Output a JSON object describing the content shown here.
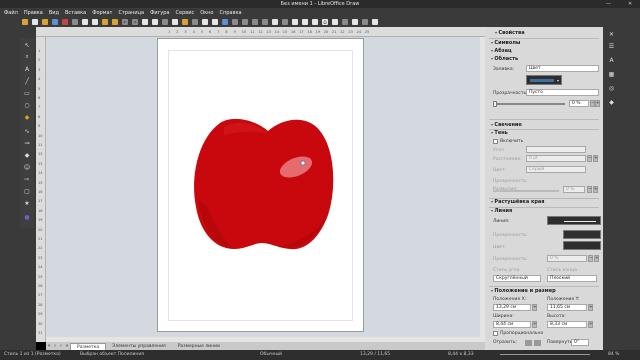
{
  "window": {
    "title": "Без имени 1 - LibreOffice Draw",
    "controls": [
      "—",
      "✕"
    ]
  },
  "menu": [
    "Файл",
    "Правка",
    "Вид",
    "Вставка",
    "Формат",
    "Страница",
    "Фигура",
    "Сервис",
    "Окно",
    "Справка"
  ],
  "ruler": {
    "top": [
      "1",
      "2",
      "3",
      "4",
      "5",
      "6",
      "7",
      "8",
      "9",
      "10",
      "11",
      "12",
      "13",
      "14",
      "15",
      "16",
      "17",
      "18",
      "19",
      "20",
      "21",
      "22",
      "23",
      "24",
      "25"
    ],
    "left": [
      "1",
      "2",
      "3",
      "4",
      "5",
      "6",
      "7",
      "8",
      "9",
      "10",
      "11",
      "12",
      "13",
      "14",
      "15",
      "16",
      "17",
      "18",
      "19",
      "20",
      "21",
      "22",
      "23",
      "24",
      "25",
      "26",
      "27",
      "28",
      "29",
      "30",
      "31"
    ]
  },
  "tabs": {
    "items": [
      "Разметка",
      "Элементы управления",
      "Размерные линии"
    ],
    "active": 0
  },
  "status": {
    "slide": "Стиль 1 из 1 (Разметка)",
    "selection": "Выбран объект Полилиния",
    "layer": "Обычный",
    "position": "13,29 / 11,65",
    "size": "8,44 x 8,33",
    "zoom": "84 %"
  },
  "sidebar": {
    "properties": "Свойства",
    "symbols": "Символы",
    "fill_section": "Абзац",
    "area": "Область",
    "fill_label": "Заливка:",
    "fill_value": "Цвет",
    "transparency_label": "Прозрачность:",
    "transparency_value": "Пусто",
    "transparency_percent": "0 %",
    "glow": "Свечение",
    "shadow": "Тень",
    "shadow_enable": "Включить",
    "shadow_angle_label": "Угол",
    "shadow_distance_label": "Расстояние:",
    "shadow_distance_value": "0 pt",
    "shadow_color_label": "Цвет:",
    "shadow_color_value": "Серый",
    "shadow_blur_label": "Размытие:",
    "shadow_blur_value": "0 pt",
    "shadow_transparency_label": "Прозрачность:",
    "shadow_transparency_value": "0 %",
    "soft_edge": "Растушёвка края",
    "line": "Линия",
    "line_label": "Линия:",
    "line_transparency_label": "Прозрачность:",
    "line_color_label": "Цвет:",
    "line_width_label": "Прозрачность:",
    "line_width_value": "0 %",
    "corner_label": "Стиль угла",
    "corner_value": "Скруглённый",
    "cap_label": "Стиль конца",
    "cap_value": "Плоский",
    "pos_size": "Положение и размер",
    "pos_x_label": "Положение X:",
    "pos_x_value": "13,29 см",
    "pos_y_label": "Положение Y:",
    "pos_y_value": "11,65 см",
    "width_label": "Ширина:",
    "width_value": "8,44 см",
    "height_label": "Высота:",
    "height_value": "8,33 см",
    "keep_ratio": "Пропорционально",
    "flip_label": "Отразить:",
    "rotate_label": "Повернуть:",
    "rotate_value": "0°"
  },
  "colors": {
    "apple_main": "#c8080c",
    "apple_dark": "#a9070b",
    "apple_light": "#d81e22",
    "highlight": "#e56b6e",
    "fill_swatch": "#3d6ea0"
  }
}
